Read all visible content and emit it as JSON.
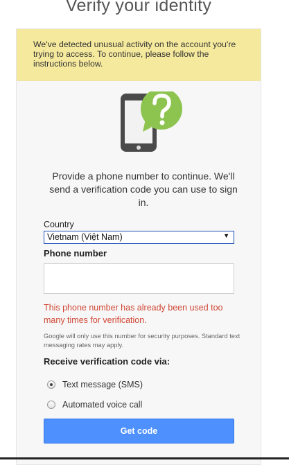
{
  "page": {
    "title": "Verify your identity"
  },
  "banner": {
    "message": "We've detected unusual activity on the account you're trying to access. To continue, please follow the instructions below."
  },
  "graphic": {
    "icon": "phone-question-icon",
    "colors": {
      "phone": "#4a4a4a",
      "bubble": "#8dc44f"
    }
  },
  "intro": {
    "text": "Provide a phone number to continue. We'll send a verification code you can use to sign in."
  },
  "country": {
    "label": "Country",
    "selected": "Vietnam (Việt Nam)",
    "arrow": "▼"
  },
  "phone": {
    "label": "Phone number",
    "value": ""
  },
  "error": {
    "text": "This phone number has already been used too many times for verification.",
    "color": "#d14836"
  },
  "fine_print": {
    "text": "Google will only use this number for security purposes. Standard text messaging rates may apply."
  },
  "receive": {
    "label": "Receive verification code via:",
    "options": [
      {
        "label": "Text message (SMS)",
        "checked": true
      },
      {
        "label": "Automated voice call",
        "checked": false
      }
    ]
  },
  "actions": {
    "get_code": "Get code",
    "accent": "#4d90fe"
  }
}
